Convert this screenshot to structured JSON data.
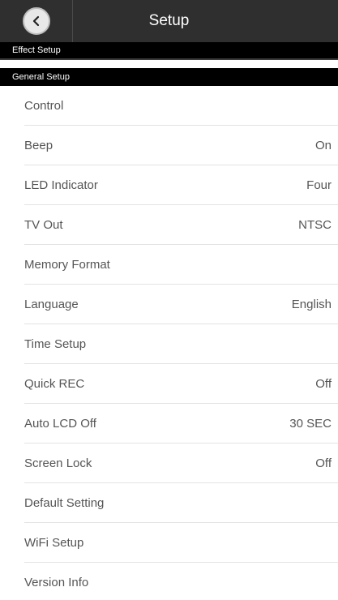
{
  "header": {
    "title": "Setup",
    "back_icon": "chevron-left-icon"
  },
  "sections": {
    "effect": "Effect Setup",
    "general": "General Setup"
  },
  "items": [
    {
      "label": "Control",
      "value": ""
    },
    {
      "label": "Beep",
      "value": "On"
    },
    {
      "label": "LED Indicator",
      "value": "Four"
    },
    {
      "label": "TV Out",
      "value": "NTSC"
    },
    {
      "label": "Memory Format",
      "value": ""
    },
    {
      "label": "Language",
      "value": "English"
    },
    {
      "label": "Time Setup",
      "value": ""
    },
    {
      "label": "Quick REC",
      "value": "Off"
    },
    {
      "label": "Auto LCD Off",
      "value": "30 SEC"
    },
    {
      "label": "Screen Lock",
      "value": "Off"
    },
    {
      "label": "Default Setting",
      "value": ""
    },
    {
      "label": "WiFi Setup",
      "value": ""
    },
    {
      "label": "Version Info",
      "value": ""
    }
  ],
  "colors": {
    "titlebar": "#2f2f2f",
    "section_header": "#000000",
    "text": "#555555"
  }
}
